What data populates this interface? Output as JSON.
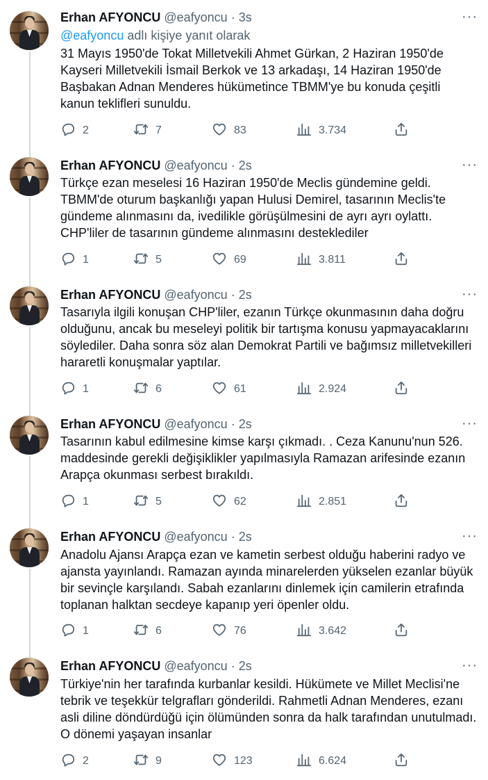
{
  "thread": {
    "reply_prefix": "",
    "reply_mention": "@eafyoncu",
    "reply_suffix": " adlı kişiye yanıt olarak"
  },
  "tweets": [
    {
      "name": "Erhan AFYONCU",
      "handle": "@eafyoncu",
      "time": "3s",
      "text": "31 Mayıs 1950'de Tokat Milletvekili Ahmet Gürkan, 2 Haziran 1950'de Kayseri Milletvekili İsmail Berkok ve 13 arkadaşı, 14 Haziran 1950'de Başbakan Adnan Menderes hükümetince TBMM'ye bu konuda çeşitli kanun teklifleri sunuldu.",
      "replies": "2",
      "retweets": "7",
      "likes": "83",
      "views": "3.734"
    },
    {
      "name": "Erhan AFYONCU",
      "handle": "@eafyoncu",
      "time": "2s",
      "text": "Türkçe ezan meselesi 16 Haziran 1950'de Meclis gündemine geldi. TBMM'de oturum başkanlığı yapan Hulusi Demirel, tasarının Meclis'te gündeme alınmasını da, ivedilikle görüşülmesini de ayrı ayrı oylattı. CHP'liler de tasarının gündeme alınmasını desteklediler",
      "replies": "1",
      "retweets": "5",
      "likes": "69",
      "views": "3.811"
    },
    {
      "name": "Erhan AFYONCU",
      "handle": "@eafyoncu",
      "time": "2s",
      "text": "Tasarıyla ilgili konuşan CHP'liler, ezanın Türkçe okunmasının daha doğru olduğunu, ancak bu meseleyi politik bir tartışma konusu yapmayacaklarını söylediler. Daha sonra söz alan Demokrat Partili ve bağımsız milletvekilleri hararetli konuşmalar yaptılar.",
      "replies": "1",
      "retweets": "6",
      "likes": "61",
      "views": "2.924"
    },
    {
      "name": "Erhan AFYONCU",
      "handle": "@eafyoncu",
      "time": "2s",
      "text": "Tasarının kabul edilmesine kimse karşı çıkmadı. . Ceza Kanunu'nun 526. maddesinde gerekli değişiklikler yapılmasıyla Ramazan arifesinde ezanın Arapça okunması serbest bırakıldı.",
      "replies": "1",
      "retweets": "5",
      "likes": "62",
      "views": "2.851"
    },
    {
      "name": "Erhan AFYONCU",
      "handle": "@eafyoncu",
      "time": "2s",
      "text": "Anadolu Ajansı  Arapça ezan ve kametin serbest olduğu haberini radyo ve ajansta yayınlandı. Ramazan ayında minarelerden yükselen ezanlar büyük bir sevinçle karşılandı. Sabah ezanlarını dinlemek için camilerin etrafında toplanan halktan secdeye kapanıp yeri öpenler oldu.",
      "replies": "1",
      "retweets": "6",
      "likes": "76",
      "views": "3.642"
    },
    {
      "name": "Erhan AFYONCU",
      "handle": "@eafyoncu",
      "time": "2s",
      "text": "Türkiye'nin her tarafında kurbanlar kesildi. Hükümete ve Millet Meclisi'ne tebrik ve teşekkür telgrafları gönderildi. Rahmetli Adnan Menderes, ezanı asli diline döndürdüğü için ölümünden sonra da halk tarafından unutulmadı. O dönemi yaşayan insanlar",
      "replies": "2",
      "retweets": "9",
      "likes": "123",
      "views": "6.624"
    }
  ]
}
